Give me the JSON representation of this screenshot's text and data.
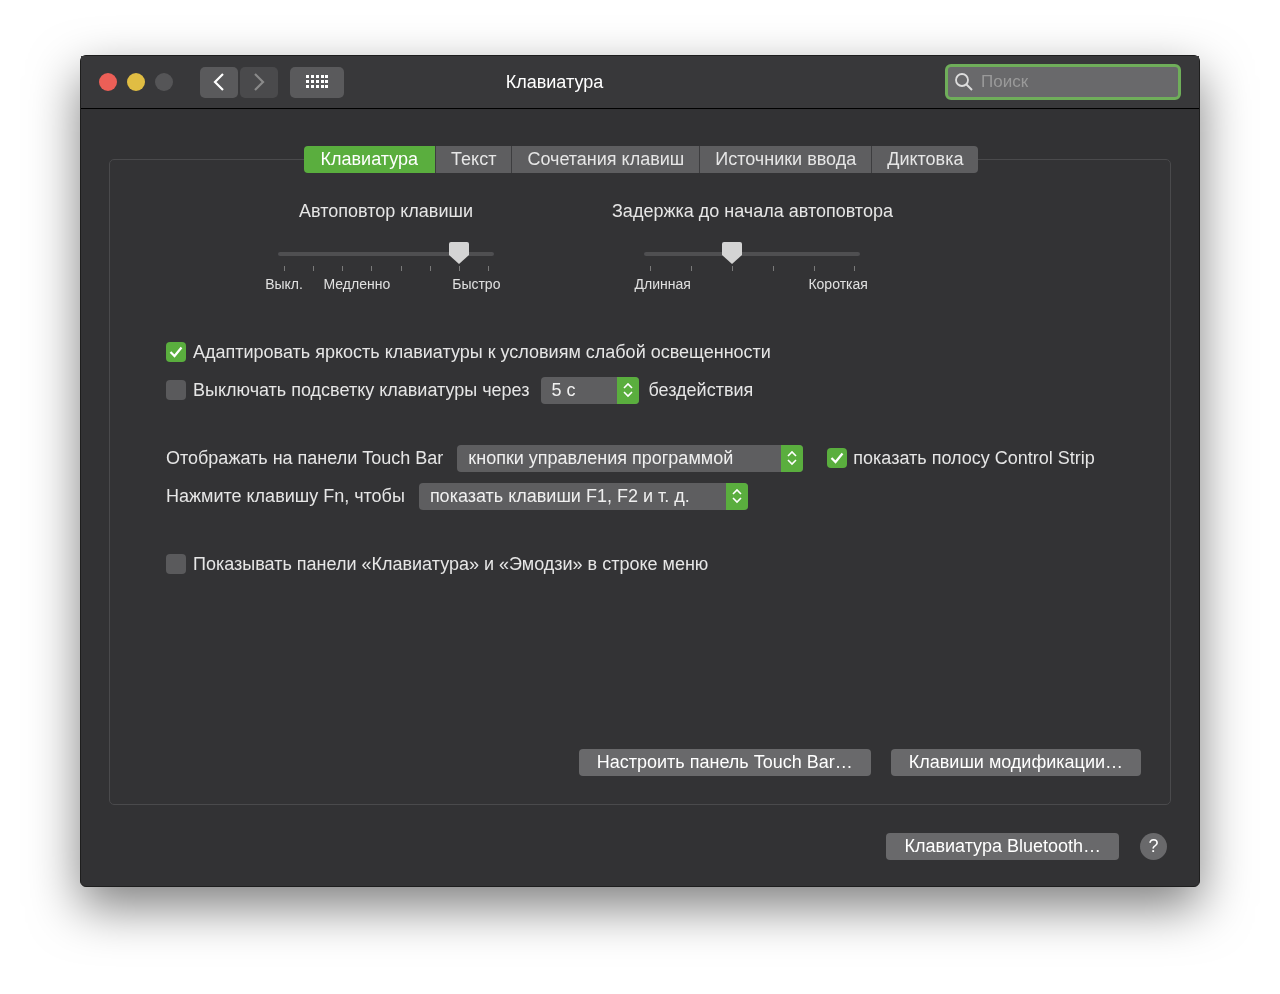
{
  "window": {
    "title": "Клавиатура"
  },
  "search": {
    "placeholder": "Поиск"
  },
  "tabs": [
    {
      "label": "Клавиатура",
      "selected": true
    },
    {
      "label": "Текст",
      "selected": false
    },
    {
      "label": "Сочетания клавиш",
      "selected": false
    },
    {
      "label": "Источники ввода",
      "selected": false
    },
    {
      "label": "Диктовка",
      "selected": false
    }
  ],
  "sliders": [
    {
      "title": "Автоповтор клавиши",
      "level": 0.857,
      "labels": [
        "Выкл.",
        "Медленно",
        "Быстро"
      ]
    },
    {
      "title": "Задержка до начала автоповтора",
      "level": 0.4,
      "labels": [
        "Длинная",
        "Короткая"
      ]
    }
  ],
  "setting_groups": [
    [
      {
        "kind": "checkbox",
        "checked": true,
        "label": "Адаптировать яркость клавиатуры к условиям слабой освещенности"
      },
      {
        "kind": "checkbox_popup",
        "checked": false,
        "label": "Выключать подсветку клавиатуры через",
        "popup": "5 с",
        "suffix": "бездействия"
      }
    ],
    [
      {
        "kind": "popup_checkbox",
        "label": "Отображать на панели Touch Bar",
        "popup": "кнопки управления программой",
        "checked": true,
        "check_label": "показать полосу Control Strip"
      },
      {
        "kind": "popup",
        "label": "Нажмите клавишу Fn, чтобы",
        "popup": "показать клавиши F1, F2 и т. д."
      }
    ],
    [
      {
        "kind": "checkbox",
        "checked": false,
        "label": "Показывать панели «Клавиатура» и «Эмодзи» в строке меню"
      }
    ]
  ],
  "panel_buttons": [
    "Настроить панель Touch Bar…",
    "Клавиши модификации…"
  ],
  "footer_button": "Клавиатура Bluetooth…",
  "help_button": "?"
}
